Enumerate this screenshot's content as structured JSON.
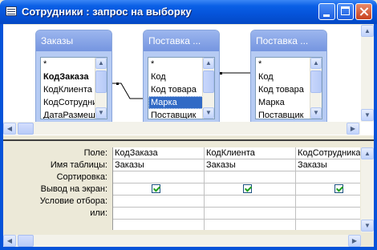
{
  "window": {
    "title": "Сотрудники : запрос на выборку",
    "min_label": "",
    "max_label": "",
    "close_label": ""
  },
  "tables": [
    {
      "name": "Заказы",
      "fields": [
        "*",
        "КодЗаказа",
        "КодКлиента",
        "КодСотрудника",
        "ДатаРазмещения"
      ],
      "bold_index": 1,
      "selected_index": -1
    },
    {
      "name": "Поставка ...",
      "fields": [
        "*",
        "Код",
        "Код товара",
        "Марка",
        "Поставщик"
      ],
      "bold_index": -1,
      "selected_index": 3
    },
    {
      "name": "Поставка ...",
      "fields": [
        "*",
        "Код",
        "Код товара",
        "Марка",
        "Поставщик"
      ],
      "bold_index": -1,
      "selected_index": -1
    }
  ],
  "grid": {
    "row_labels": [
      "Поле:",
      "Имя таблицы:",
      "Сортировка:",
      "Вывод на экран:",
      "Условие отбора:",
      "или:"
    ],
    "columns": [
      {
        "field": "КодЗаказа",
        "table": "Заказы",
        "sort": "",
        "show": true,
        "criteria": "",
        "or": ""
      },
      {
        "field": "КодКлиента",
        "table": "Заказы",
        "sort": "",
        "show": true,
        "criteria": "",
        "or": ""
      },
      {
        "field": "КодСотрудника",
        "table": "Заказы",
        "sort": "",
        "show": true,
        "criteria": "",
        "or": ""
      }
    ]
  },
  "colors": {
    "titlebar": "#0553d9",
    "table_header": "#7595e0",
    "selection": "#316ac5"
  }
}
